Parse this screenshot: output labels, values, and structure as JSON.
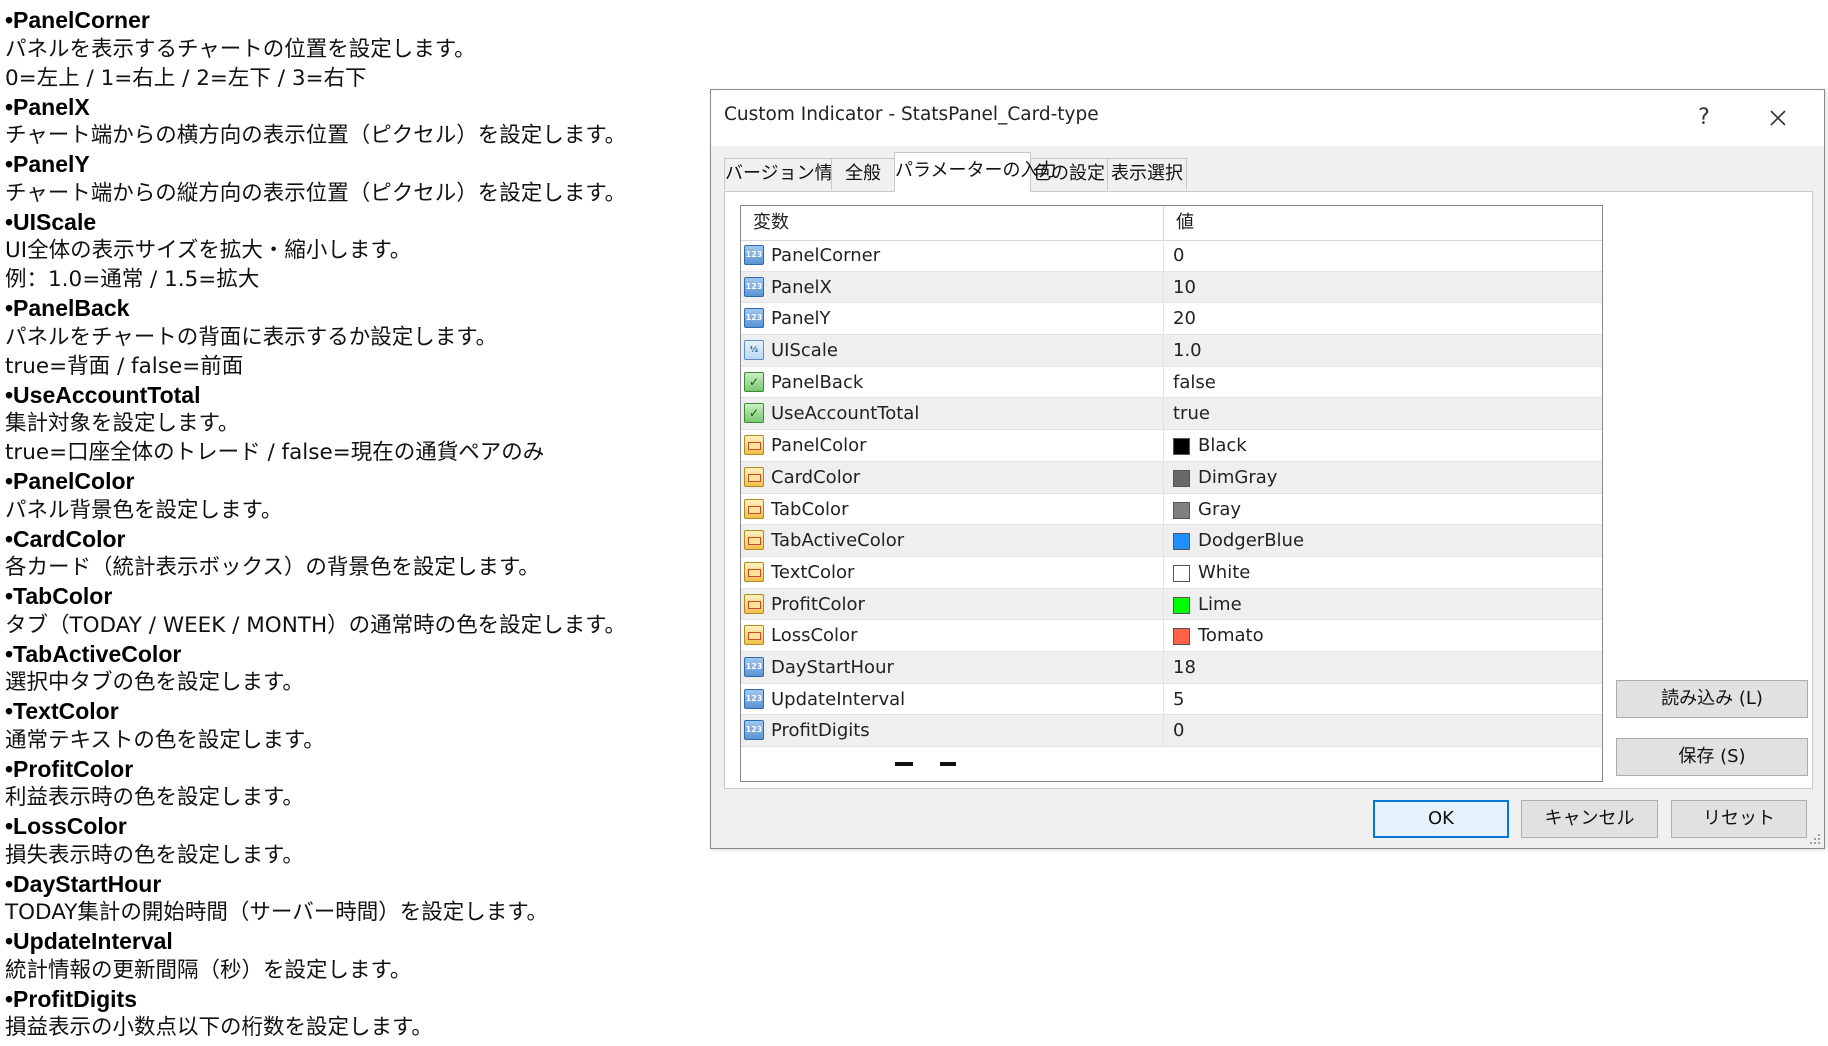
{
  "doc": [
    {
      "name": "•PanelCorner",
      "lines": [
        "パネルを表示するチャートの位置を設定します。",
        "0=左上 / 1=右上 / 2=左下 / 3=右下"
      ]
    },
    {
      "name": "•PanelX",
      "lines": [
        "チャート端からの横方向の表示位置（ピクセル）を設定します。"
      ]
    },
    {
      "name": "•PanelY",
      "lines": [
        "チャート端からの縦方向の表示位置（ピクセル）を設定します。"
      ]
    },
    {
      "name": "•UIScale",
      "lines": [
        "UI全体の表示サイズを拡大・縮小します。",
        "例：1.0=通常 / 1.5=拡大"
      ]
    },
    {
      "name": "•PanelBack",
      "lines": [
        "パネルをチャートの背面に表示するか設定します。",
        "true=背面 / false=前面"
      ]
    },
    {
      "name": "•UseAccountTotal",
      "lines": [
        "集計対象を設定します。",
        "true=口座全体のトレード / false=現在の通貨ペアのみ"
      ]
    },
    {
      "name": "•PanelColor",
      "lines": [
        "パネル背景色を設定します。"
      ]
    },
    {
      "name": "•CardColor",
      "lines": [
        "各カード（統計表示ボックス）の背景色を設定します。"
      ]
    },
    {
      "name": "•TabColor",
      "lines": [
        "タブ（TODAY / WEEK / MONTH）の通常時の色を設定します。"
      ]
    },
    {
      "name": "•TabActiveColor",
      "lines": [
        "選択中タブの色を設定します。"
      ]
    },
    {
      "name": "•TextColor",
      "lines": [
        "通常テキストの色を設定します。"
      ]
    },
    {
      "name": "•ProfitColor",
      "lines": [
        "利益表示時の色を設定します。"
      ]
    },
    {
      "name": "•LossColor",
      "lines": [
        "損失表示時の色を設定します。"
      ]
    },
    {
      "name": "•DayStartHour",
      "lines": [
        "TODAY集計の開始時間（サーバー時間）を設定します。"
      ]
    },
    {
      "name": "•UpdateInterval",
      "lines": [
        "統計情報の更新間隔（秒）を設定します。"
      ]
    },
    {
      "name": "•ProfitDigits",
      "lines": [
        "損益表示の小数点以下の桁数を設定します。"
      ]
    }
  ],
  "dialog": {
    "title": "Custom Indicator - StatsPanel_Card-type",
    "help": "?",
    "tabs": [
      "バージョン情報",
      "全般",
      "パラメーターの入力",
      "色の設定",
      "表示選択"
    ],
    "active_tab": 2,
    "grid": {
      "header_variable": "変数",
      "header_value": "値",
      "rows": [
        {
          "name": "PanelCorner",
          "value": "0",
          "type": "int"
        },
        {
          "name": "PanelX",
          "value": "10",
          "type": "int"
        },
        {
          "name": "PanelY",
          "value": "20",
          "type": "int"
        },
        {
          "name": "UIScale",
          "value": "1.0",
          "type": "double"
        },
        {
          "name": "PanelBack",
          "value": "false",
          "type": "bool"
        },
        {
          "name": "UseAccountTotal",
          "value": "true",
          "type": "bool"
        },
        {
          "name": "PanelColor",
          "value": "Black",
          "type": "color",
          "swatch": "#000000"
        },
        {
          "name": "CardColor",
          "value": "DimGray",
          "type": "color",
          "swatch": "#696969"
        },
        {
          "name": "TabColor",
          "value": "Gray",
          "type": "color",
          "swatch": "#808080"
        },
        {
          "name": "TabActiveColor",
          "value": "DodgerBlue",
          "type": "color",
          "swatch": "#1e90ff"
        },
        {
          "name": "TextColor",
          "value": "White",
          "type": "color",
          "swatch": "#ffffff"
        },
        {
          "name": "ProfitColor",
          "value": "Lime",
          "type": "color",
          "swatch": "#00ff00"
        },
        {
          "name": "LossColor",
          "value": "Tomato",
          "type": "color",
          "swatch": "#ff6347"
        },
        {
          "name": "DayStartHour",
          "value": "18",
          "type": "int"
        },
        {
          "name": "UpdateInterval",
          "value": "5",
          "type": "int"
        },
        {
          "name": "ProfitDigits",
          "value": "0",
          "type": "int"
        }
      ]
    },
    "load_button": "読み込み (L)",
    "save_button": "保存 (S)",
    "ok_button": "OK",
    "cancel_button": "キャンセル",
    "reset_button": "リセット"
  }
}
